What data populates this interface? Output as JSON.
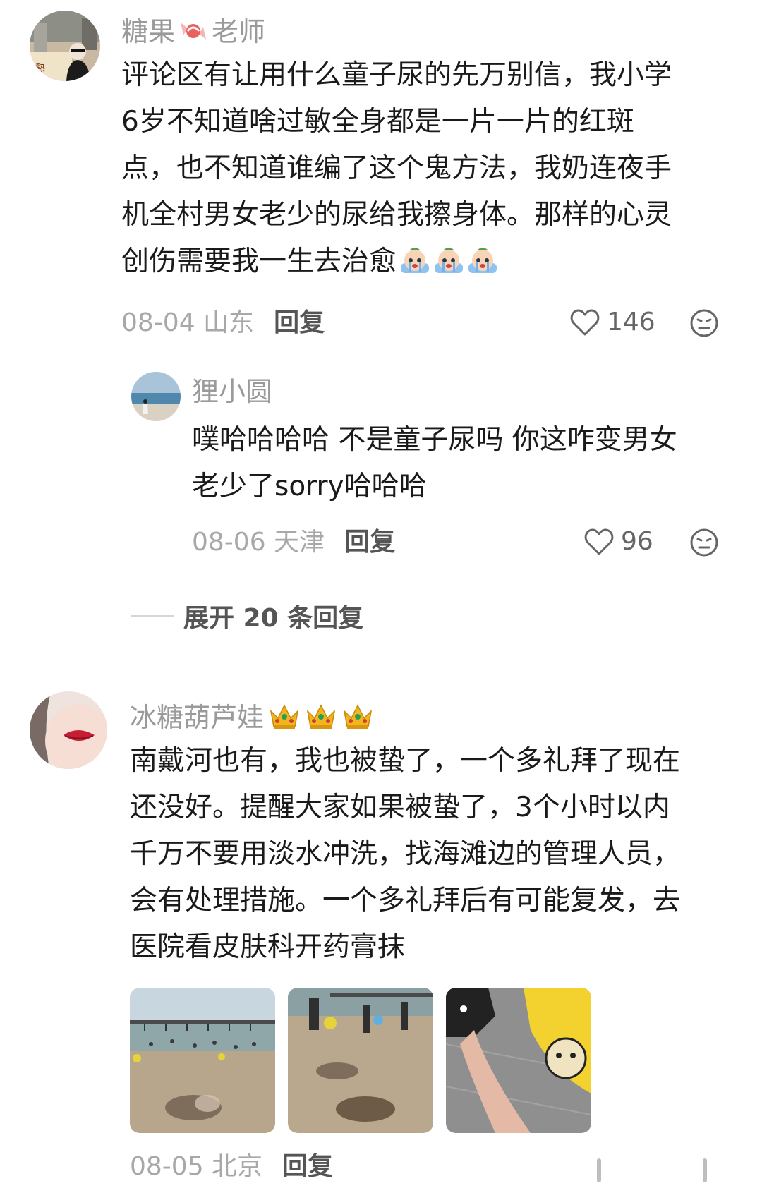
{
  "comments": [
    {
      "user": "糖果",
      "user_suffix": "老师",
      "text_lines": [
        "评论区有让用什么童子尿的先万别信，我小学",
        "6岁不知道啥过敏全身都是一片一片的红斑",
        "点，也不知道谁编了这个鬼方法，我奶连夜手",
        "机全村男女老少的尿给我擦身体。那样的心灵",
        "创伤需要我一生去治愈"
      ],
      "date_location": "08-04 山东",
      "reply_label": "回复",
      "likes": "146",
      "replies": [
        {
          "user": "狸小圆",
          "text_lines": [
            "噗哈哈哈哈 不是童子尿吗 你这咋变男女",
            "老少了sorry哈哈哈"
          ],
          "date_location": "08-06 天津",
          "reply_label": "回复",
          "likes": "96"
        }
      ],
      "expand_label": "展开 20 条回复"
    },
    {
      "user": "冰糖葫芦娃",
      "text_lines": [
        "南戴河也有，我也被蛰了，一个多礼拜了现在",
        "还没好。提醒大家如果被蛰了，3个小时以内",
        "千万不要用淡水冲洗，找海滩边的管理人员，",
        "会有处理措施。一个多礼拜后有可能复发，去",
        "医院看皮肤科开药膏抹"
      ],
      "date_location": "08-05 北京",
      "reply_label": "回复"
    }
  ],
  "colors": {
    "username": "#9a9a9a",
    "text": "#1a1a1a",
    "meta": "#a8a8a8",
    "action": "#555555"
  },
  "icons": {
    "like": "heart-outline-icon",
    "dislike": "neutral-face-icon",
    "crying_emoji": "crying-face-emoji",
    "crown": "crown-icon",
    "candy": "candy-icon"
  }
}
